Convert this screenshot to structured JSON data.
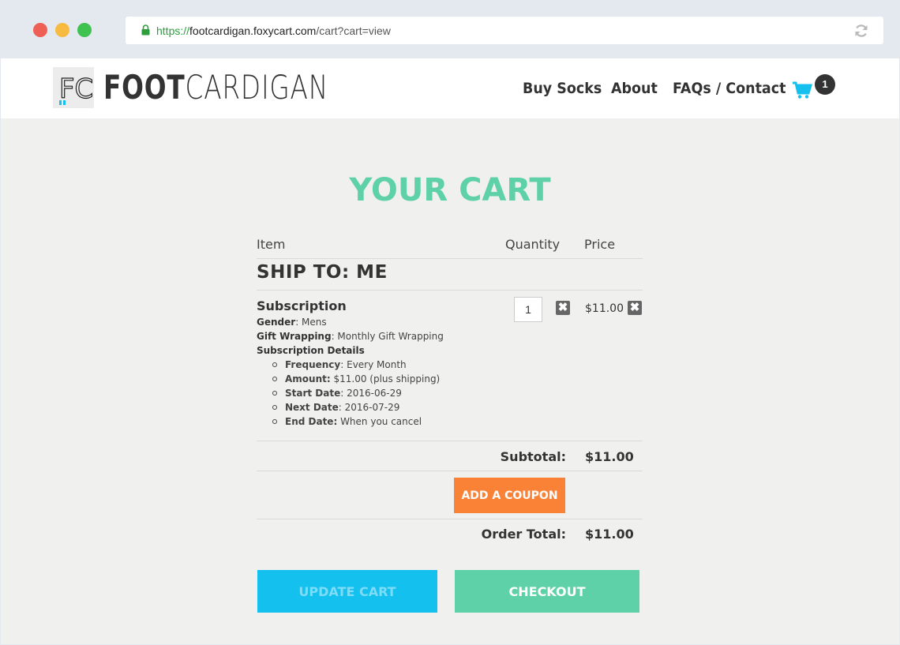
{
  "browser": {
    "url_scheme": "https://",
    "url_host": "footcardigan.foxycart.com",
    "url_path": "/cart?cart=view",
    "lock_icon": "lock-icon",
    "reload_icon": "reload-icon"
  },
  "header": {
    "logo_mark": "FC",
    "logo_bold": "FOOT",
    "logo_light": "CARDIGAN",
    "nav": [
      "Buy Socks",
      "About",
      "FAQs / Contact"
    ],
    "cart_icon": "cart-icon",
    "cart_count": "1",
    "accent": "#13c0ee"
  },
  "cart": {
    "title": "YOUR CART",
    "col_item": "Item",
    "col_quantity": "Quantity",
    "col_price": "Price",
    "ship_to": "SHIP TO: ME",
    "item": {
      "name": "Subscription",
      "gender_label": "Gender",
      "gender_value": ": Mens",
      "wrap_label": "Gift Wrapping",
      "wrap_value": ": Monthly Gift Wrapping",
      "details_label": "Subscription Details",
      "details": [
        {
          "label": "Frequency",
          "value": ": Every Month"
        },
        {
          "label": "Amount:",
          "value": " $11.00 (plus shipping)"
        },
        {
          "label": "Start Date",
          "value": ": 2016-06-29"
        },
        {
          "label": "Next Date",
          "value": ": 2016-07-29"
        },
        {
          "label": "End Date:",
          "value": " When you cancel"
        }
      ],
      "quantity": "1",
      "price": "$11.00",
      "remove_glyph": "✖"
    },
    "subtotal_label": "Subtotal:",
    "subtotal_value": "$11.00",
    "coupon_button": "ADD A COUPON",
    "order_total_label": "Order Total:",
    "order_total_value": "$11.00",
    "update_button": "UPDATE CART",
    "checkout_button": "CHECKOUT"
  },
  "colors": {
    "title_green": "#5fd1a8",
    "coupon_orange": "#fa8236",
    "update_blue": "#13c0ee",
    "checkout_green": "#5fd1a8"
  }
}
